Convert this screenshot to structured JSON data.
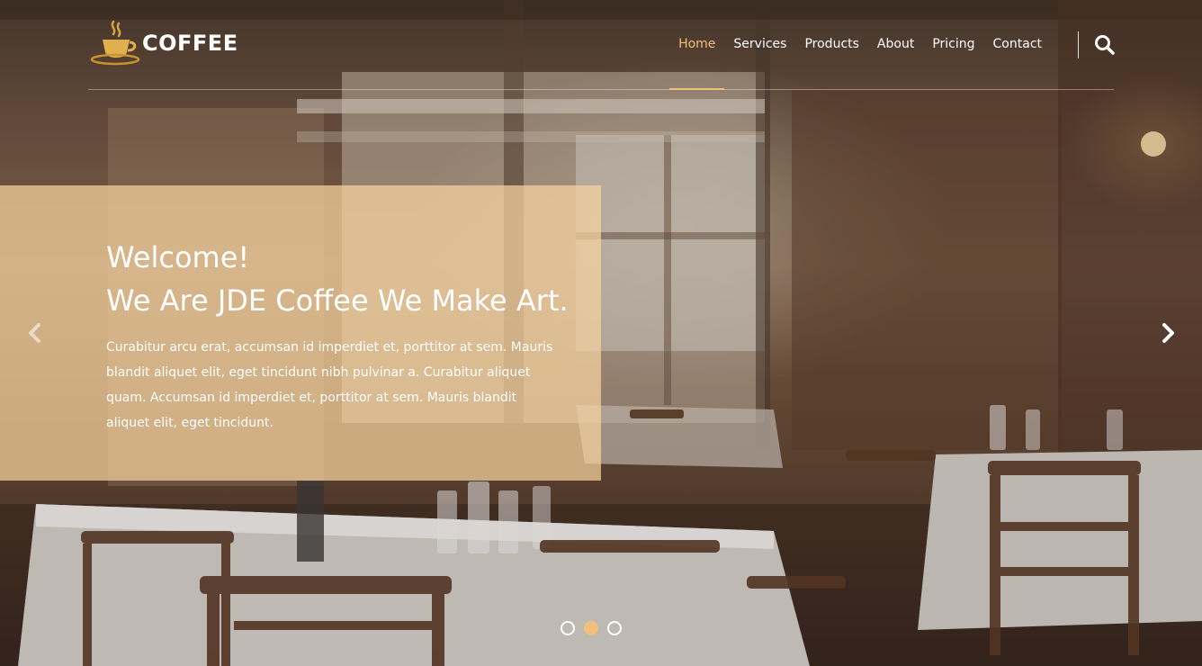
{
  "brand": {
    "name": "COFFEE",
    "logo_icon": "coffee-cup-icon"
  },
  "nav": {
    "items": [
      {
        "label": "Home",
        "active": true
      },
      {
        "label": "Services",
        "active": false
      },
      {
        "label": "Products",
        "active": false
      },
      {
        "label": "About",
        "active": false
      },
      {
        "label": "Pricing",
        "active": false
      },
      {
        "label": "Contact",
        "active": false
      }
    ],
    "search_icon": "search-icon"
  },
  "hero": {
    "title_line1": "Welcome!",
    "title_line2": "We Are JDE Coffee We Make Art.",
    "text": "Curabitur arcu erat, accumsan id imperdiet et, porttitor at sem. Mauris blandit aliquet elit, eget tincidunt nibh pulvinar a. Curabitur aliquet quam. Accumsan id imperdiet et, porttitor at sem. Mauris blandit aliquet elit, eget tincidunt.",
    "prev_icon": "chevron-left-icon",
    "next_icon": "chevron-right-icon"
  },
  "carousel": {
    "slide_count": 3,
    "active_index": 1
  },
  "colors": {
    "accent": "#f3c07b",
    "caption_bg": "#f7d2a0",
    "text": "#ffffff"
  }
}
